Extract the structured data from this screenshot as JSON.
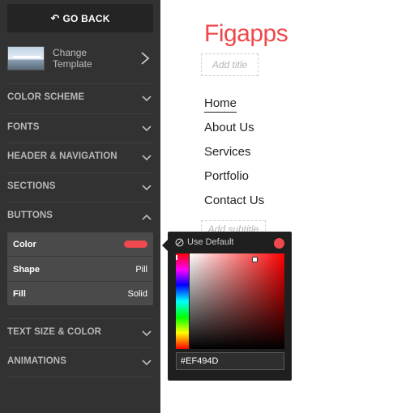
{
  "sidebar": {
    "go_back": "GO BACK",
    "template_label": "Change Template",
    "sections": [
      {
        "label": "COLOR SCHEME",
        "expanded": false
      },
      {
        "label": "FONTS",
        "expanded": false
      },
      {
        "label": "HEADER & NAVIGATION",
        "expanded": false
      },
      {
        "label": "SECTIONS",
        "expanded": false
      },
      {
        "label": "BUTTONS",
        "expanded": true
      },
      {
        "label": "TEXT SIZE & COLOR",
        "expanded": false
      },
      {
        "label": "ANIMATIONS",
        "expanded": false
      }
    ],
    "buttons_panel": {
      "color_label": "Color",
      "shape_label": "Shape",
      "shape_value": "Pill",
      "fill_label": "Fill",
      "fill_value": "Solid"
    }
  },
  "preview": {
    "logo": "Figapps",
    "title_placeholder": "Add title",
    "subtitle_placeholder": "Add subtitle",
    "nav": [
      "Home",
      "About Us",
      "Services",
      "Portfolio",
      "Contact Us"
    ],
    "active_nav": "Home"
  },
  "picker": {
    "use_default": "Use Default",
    "hex": "#EF494D"
  },
  "colors": {
    "accent": "#ef494d",
    "sidebar_bg": "#323232"
  },
  "icons": {
    "go_back": "reply-arrow-icon",
    "template": "chevron-right-icon",
    "section": "chevron-down-icon",
    "use_default": "prohibited-icon"
  }
}
